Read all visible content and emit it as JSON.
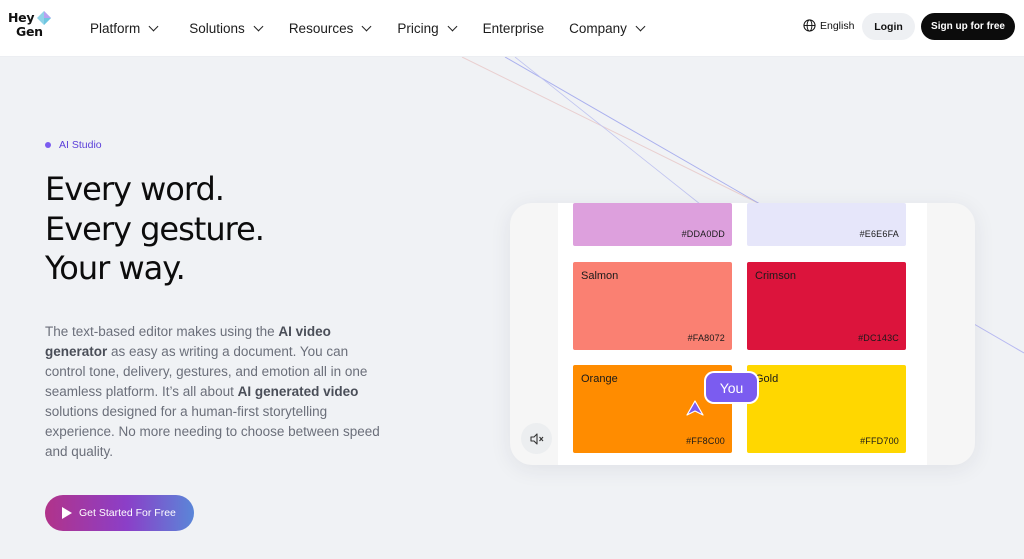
{
  "brand": {
    "line1": "Hey",
    "line2": "Gen"
  },
  "nav": {
    "items": [
      {
        "label": "Platform",
        "dropdown": true
      },
      {
        "label": "Solutions",
        "dropdown": true
      },
      {
        "label": "Resources",
        "dropdown": true
      },
      {
        "label": "Pricing",
        "dropdown": true
      },
      {
        "label": "Enterprise",
        "dropdown": false
      },
      {
        "label": "Company",
        "dropdown": true
      }
    ],
    "language": "English",
    "login": "Login",
    "signup": "Sign up for free"
  },
  "hero": {
    "badge": "AI Studio",
    "headline": [
      "Every word.",
      "Every gesture.",
      "Your way."
    ],
    "description": {
      "p1": "The text-based editor makes using the ",
      "b1": "AI video generator",
      "p2": " as easy as writing a document. You can control tone, delivery, gestures, and emotion all in one seamless platform. It’s all about ",
      "b2": "AI generated video",
      "p3": " solutions designed for a human-first storytelling experience. No more needing to choose between speed and quality."
    },
    "cta": "Get Started For Free"
  },
  "preview": {
    "swatches": [
      {
        "name": "",
        "hex": "#DDA0DD",
        "color": "#DDA0DD"
      },
      {
        "name": "",
        "hex": "#E6E6FA",
        "color": "#E6E6FA"
      },
      {
        "name": "Salmon",
        "hex": "#FA8072",
        "color": "#FA8072"
      },
      {
        "name": "Crimson",
        "hex": "#DC143C",
        "color": "#DC143C"
      },
      {
        "name": "Orange",
        "hex": "#FF8C00",
        "color": "#FF8C00"
      },
      {
        "name": "Gold",
        "hex": "#FFD700",
        "color": "#FFD700"
      }
    ],
    "you_tag": "You"
  },
  "colors": {
    "accent": "#7b5cf0",
    "header_bg": "#ffffff",
    "page_bg": "#f0f2f5",
    "signup_bg": "#0c0c0c"
  },
  "icons": {
    "logo": "heygen-logo-icon",
    "language": "globe-icon",
    "chevron": "chevron-down-icon",
    "cta": "play-icon",
    "mute": "speaker-muted-icon",
    "cursor": "pointer-cursor-icon"
  }
}
